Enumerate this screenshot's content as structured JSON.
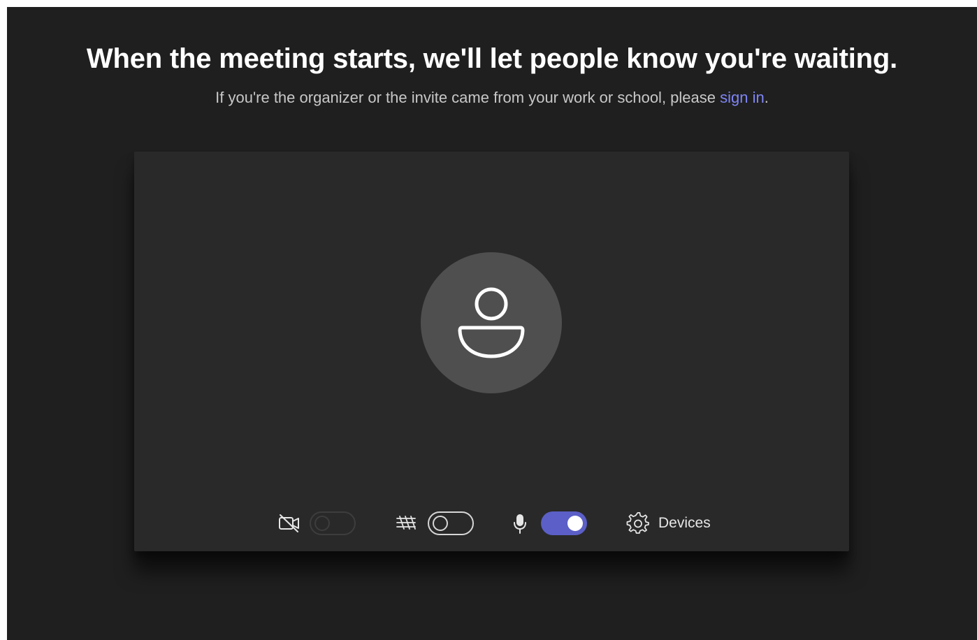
{
  "header": {
    "title": "When the meeting starts, we'll let people know you're waiting.",
    "subtitle_prefix": "If you're the organizer or the invite came from your work or school, please ",
    "sign_in_link": "sign in",
    "subtitle_suffix": "."
  },
  "preview": {
    "avatar_icon": "person-icon"
  },
  "controls": {
    "camera": {
      "icon": "camera-off-icon",
      "state": "disabled"
    },
    "background_effects": {
      "icon": "background-effects-icon",
      "state": "off"
    },
    "microphone": {
      "icon": "microphone-icon",
      "state": "on"
    },
    "devices": {
      "icon": "gear-icon",
      "label": "Devices"
    }
  },
  "colors": {
    "page_bg": "#1f1f1f",
    "card_bg": "#292929",
    "avatar_bg": "#4f4f4f",
    "accent": "#5b5fc7",
    "link": "#7f85f5"
  }
}
